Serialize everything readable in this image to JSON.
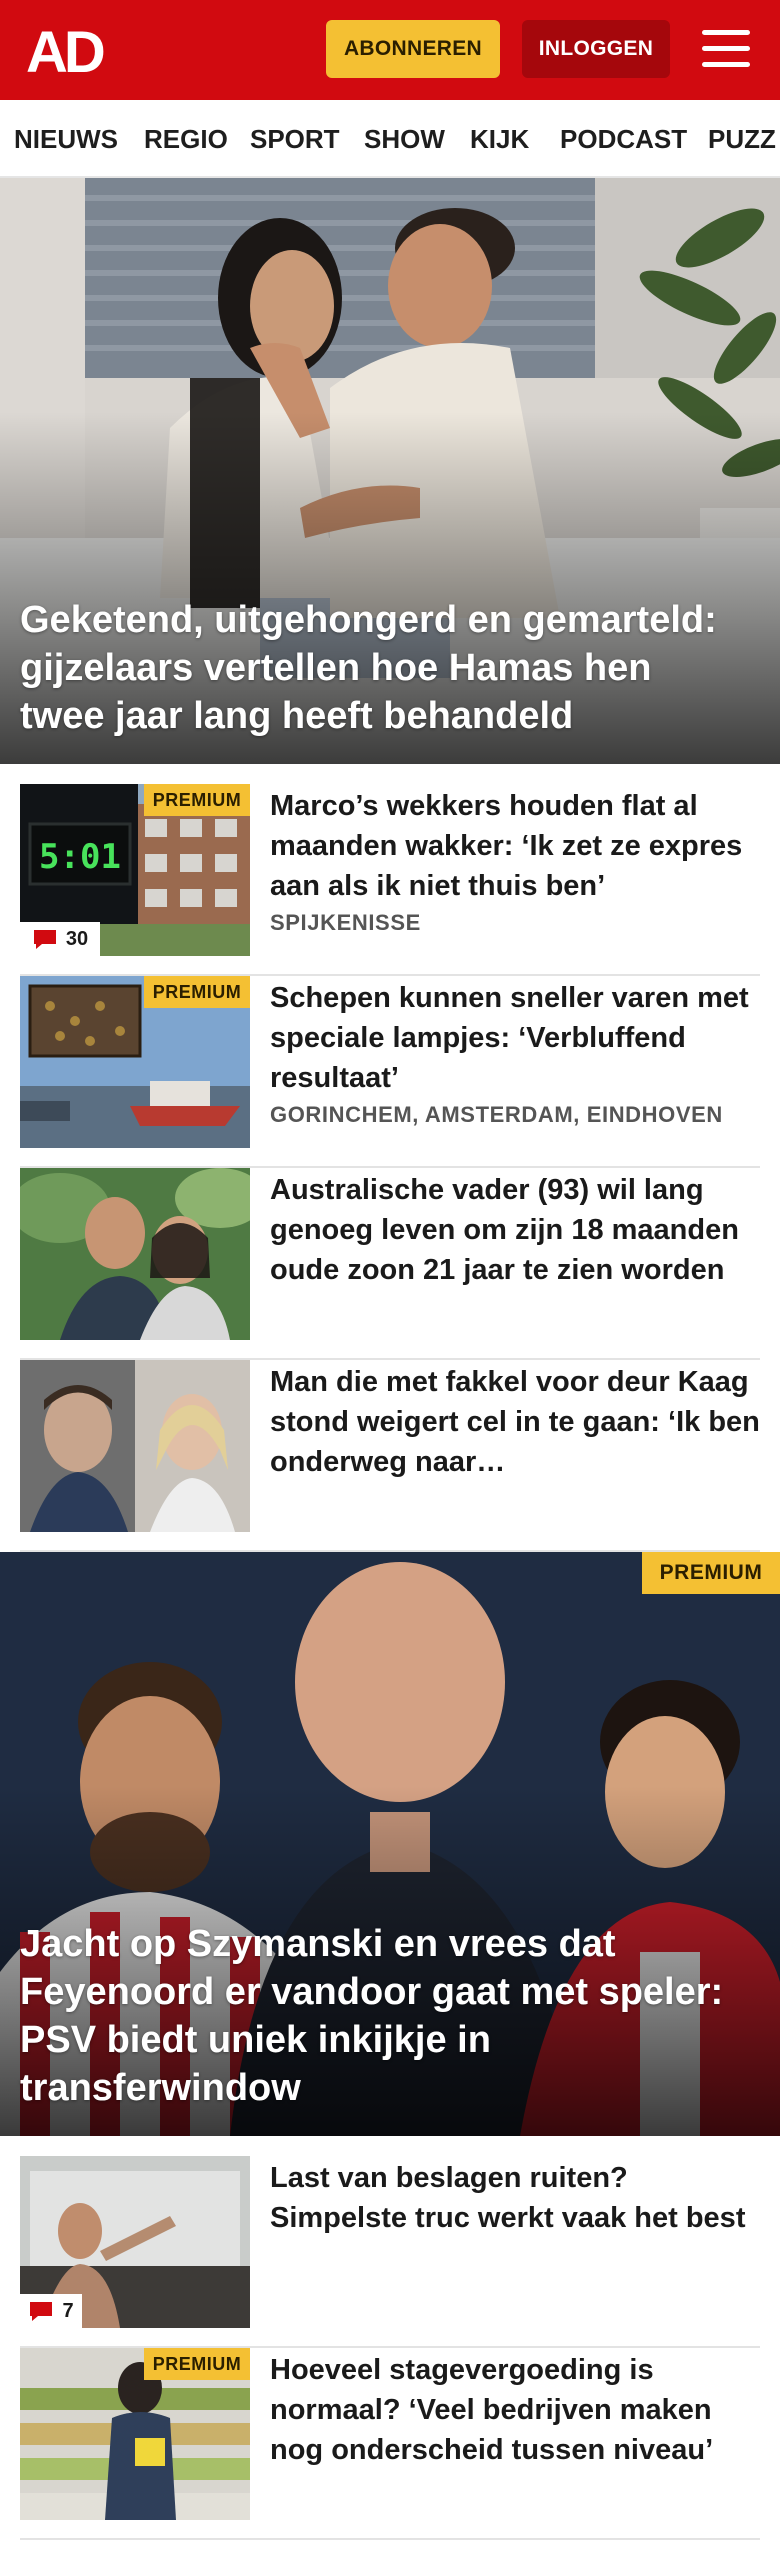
{
  "header": {
    "logo_text": "AD",
    "subscribe_label": "ABONNEREN",
    "login_label": "INLOGGEN",
    "menu_icon": "hamburger-menu-icon"
  },
  "nav": {
    "items": [
      "NIEUWS",
      "REGIO",
      "SPORT",
      "SHOW",
      "KIJK",
      "PODCAST",
      "PUZZ"
    ]
  },
  "hero1": {
    "title": "Geketend, uitgehongerd en gemarteld: gijzelaars vertellen hoe Hamas hen twee jaar lang heeft behandeld"
  },
  "articles": [
    {
      "title": "Marco’s wekkers houden flat al maanden wakker: ‘Ik zet ze expres aan als ik niet thuis ben’",
      "location": "SPIJKENISSE",
      "premium": "PREMIUM",
      "comments": "30",
      "clock_text": "5:01"
    },
    {
      "title": "Schepen kunnen sneller varen met speciale lampjes: ‘Verbluf­fend resultaat’",
      "location": "GORINCHEM, AMSTERDAM, EINDHOVEN",
      "premium": "PREMIUM"
    },
    {
      "title": "Australische vader (93) wil lang genoeg leven om zijn 18 maanden oude zoon 21 jaar te zien worden"
    },
    {
      "title": "Man die met fakkel voor deur Kaag stond weigert cel in te gaan: ‘Ik ben onderweg naar…"
    }
  ],
  "hero2": {
    "title": "Jacht op Szymanski en vrees dat Feyenoord er vandoor gaat met speler: PSV biedt uniek inkijkje in transferwindow",
    "premium": "PREMIUM"
  },
  "articles2": [
    {
      "title": "Last van beslagen ruiten? Simpelste truc werkt vaak het best",
      "comments": "7"
    },
    {
      "title": "Hoeveel stagevergoeding is normaal? ‘Veel bedrijven maken nog onderscheid tussen niveau’",
      "premium": "PREMIUM"
    }
  ],
  "colors": {
    "brand_red": "#d10a10",
    "login_red": "#a5070c",
    "premium_yellow": "#f4c033",
    "comment_red": "#d10a10"
  }
}
